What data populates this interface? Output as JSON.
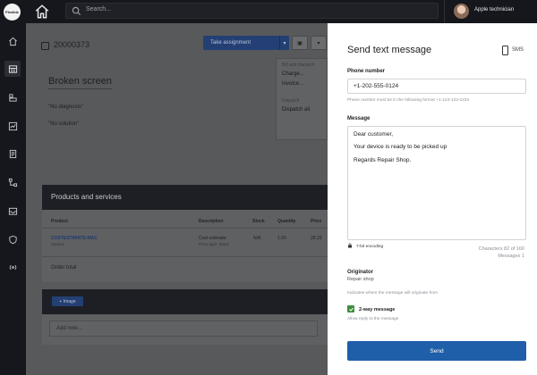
{
  "app": {
    "logo_text": "Flexibiz"
  },
  "search": {
    "placeholder": "Search..."
  },
  "user": {
    "name": "Apple technician"
  },
  "sidebar": {
    "items": [
      "home-icon",
      "grid-icon",
      "boxes-icon",
      "chart-icon",
      "document-icon",
      "flow-icon",
      "inbox-icon",
      "shield-icon",
      "broadcast-icon"
    ]
  },
  "ticket": {
    "id": "20000373",
    "take_label": "Take assignment",
    "dropdown": {
      "header": "Bill and dispatch",
      "items": [
        "Charge...",
        "Invoice..."
      ],
      "section": "Dispatch",
      "dispatch": "Dispatch all"
    },
    "device": "Broken screen",
    "diagnosis": "\"No diagnosis\"",
    "solution": "\"No solution\""
  },
  "products": {
    "title": "Products and services",
    "columns": [
      "Product",
      "Description",
      "Stock",
      "Quantity",
      "Price"
    ],
    "row": {
      "product": "COSTESTIMATE-MAC",
      "product_sub": "Service",
      "description": "Cost estimate",
      "description_sub": "Price type: Stock",
      "stock": "N/A",
      "quantity": "1.00",
      "price": "28.23"
    },
    "order_total": "Order total"
  },
  "notes": {
    "image_label": "+ Image",
    "placeholder": "Add note..."
  },
  "sms": {
    "title": "Send text message",
    "channel": "SMS",
    "phone_label": "Phone number",
    "phone_value": "+1-202-555-0124",
    "phone_hint": "Phone number must be in the following format +1-123-123-1234",
    "message_label": "Message",
    "message_lines": [
      "Dear customer,",
      "Your device is ready to be picked up",
      "Regards Repair Shop."
    ],
    "encoding": "7-bit encoding",
    "characters": "Characters  82 of 160",
    "messages": "Messages  1",
    "originator_label": "Originator",
    "originator_value": "Repair shop",
    "originator_hint": "Indicates where the message will originate from",
    "two_way_label": "2-way message",
    "two_way_hint": "Allow reply to the message",
    "two_way_checked": true,
    "send_label": "Send"
  },
  "colors": {
    "accent": "#1f5ea8",
    "dark_bar": "#15171c",
    "check_green": "#3e8e3e"
  }
}
